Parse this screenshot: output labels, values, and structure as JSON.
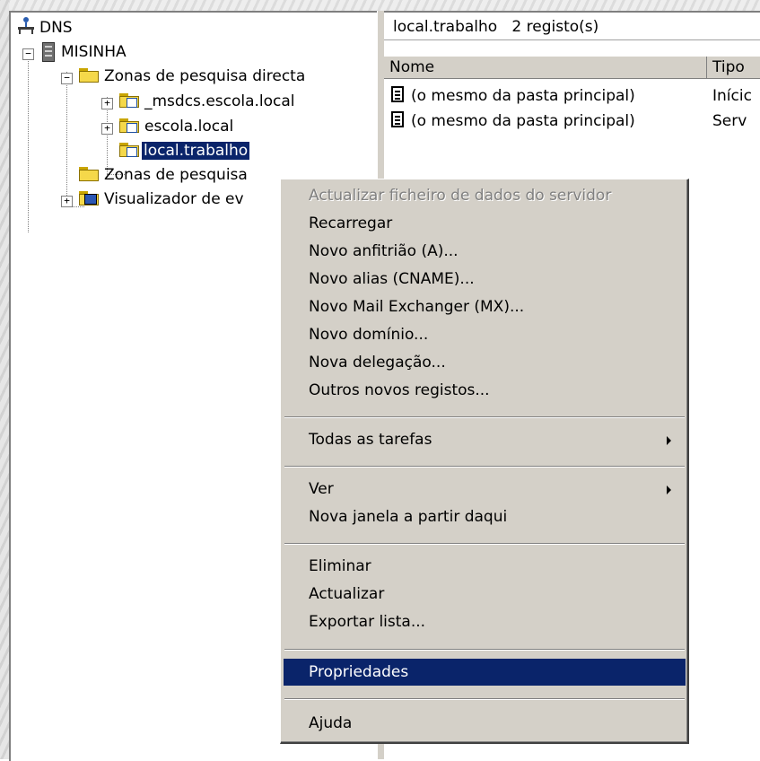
{
  "tree": {
    "root": "DNS",
    "server": "MISINHA",
    "forward_zones": "Zonas de pesquisa directa",
    "zones": [
      "_msdcs.escola.local",
      "escola.local",
      "local.trabalho"
    ],
    "reverse_zones": "Zonas de pesquisa",
    "event_viewer": "Visualizador de ev"
  },
  "right_pane": {
    "header_title": "local.trabalho",
    "header_count": "2 registo(s)",
    "columns": [
      "Nome",
      "Tipo"
    ],
    "rows": [
      {
        "name": "(o mesmo da pasta principal)",
        "type": "Inícic"
      },
      {
        "name": "(o mesmo da pasta principal)",
        "type": "Serv"
      }
    ]
  },
  "context_menu": {
    "items": [
      {
        "label": "Actualizar ficheiro de dados do servidor",
        "state": "disabled"
      },
      {
        "label": "Recarregar"
      },
      {
        "label": "Novo anfitrião (A)..."
      },
      {
        "label": "Novo alias (CNAME)..."
      },
      {
        "label": "Novo Mail Exchanger (MX)..."
      },
      {
        "label": "Novo domínio..."
      },
      {
        "label": "Nova delegação..."
      },
      {
        "label": "Outros novos registos..."
      },
      {
        "label": "Todas as tarefas",
        "submenu": true
      },
      {
        "label": "Ver",
        "submenu": true
      },
      {
        "label": "Nova janela a partir daqui"
      },
      {
        "label": "Eliminar"
      },
      {
        "label": "Actualizar"
      },
      {
        "label": "Exportar lista..."
      },
      {
        "label": "Propriedades",
        "state": "highlighted"
      },
      {
        "label": "Ajuda"
      }
    ]
  },
  "colors": {
    "selection": "#0a246a",
    "menu_bg": "#d4d0c8",
    "disabled_text": "#808080"
  }
}
